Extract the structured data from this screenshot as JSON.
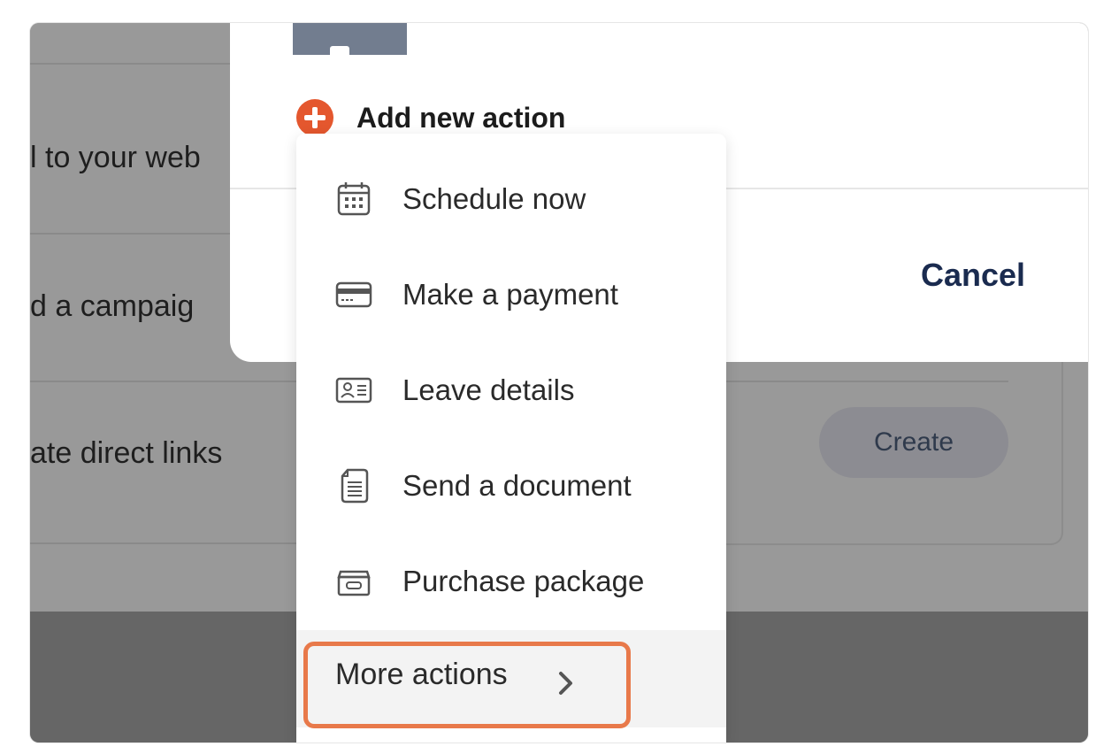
{
  "background": {
    "rows": [
      "l to your web",
      "d a campaig",
      "ate direct links"
    ],
    "create_button": "Create"
  },
  "modal": {
    "add_action_label": "Add new action",
    "cancel_label": "Cancel"
  },
  "menu": {
    "items": [
      {
        "label": "Schedule now",
        "icon": "calendar-icon"
      },
      {
        "label": "Make a payment",
        "icon": "credit-card-icon"
      },
      {
        "label": "Leave details",
        "icon": "contact-card-icon"
      },
      {
        "label": "Send a document",
        "icon": "document-icon"
      },
      {
        "label": "Purchase package",
        "icon": "package-box-icon"
      }
    ],
    "more_label": "More actions"
  },
  "colors": {
    "accent": "#e4572e",
    "highlight": "#e8794a",
    "cancel_text": "#1a2b4f"
  }
}
